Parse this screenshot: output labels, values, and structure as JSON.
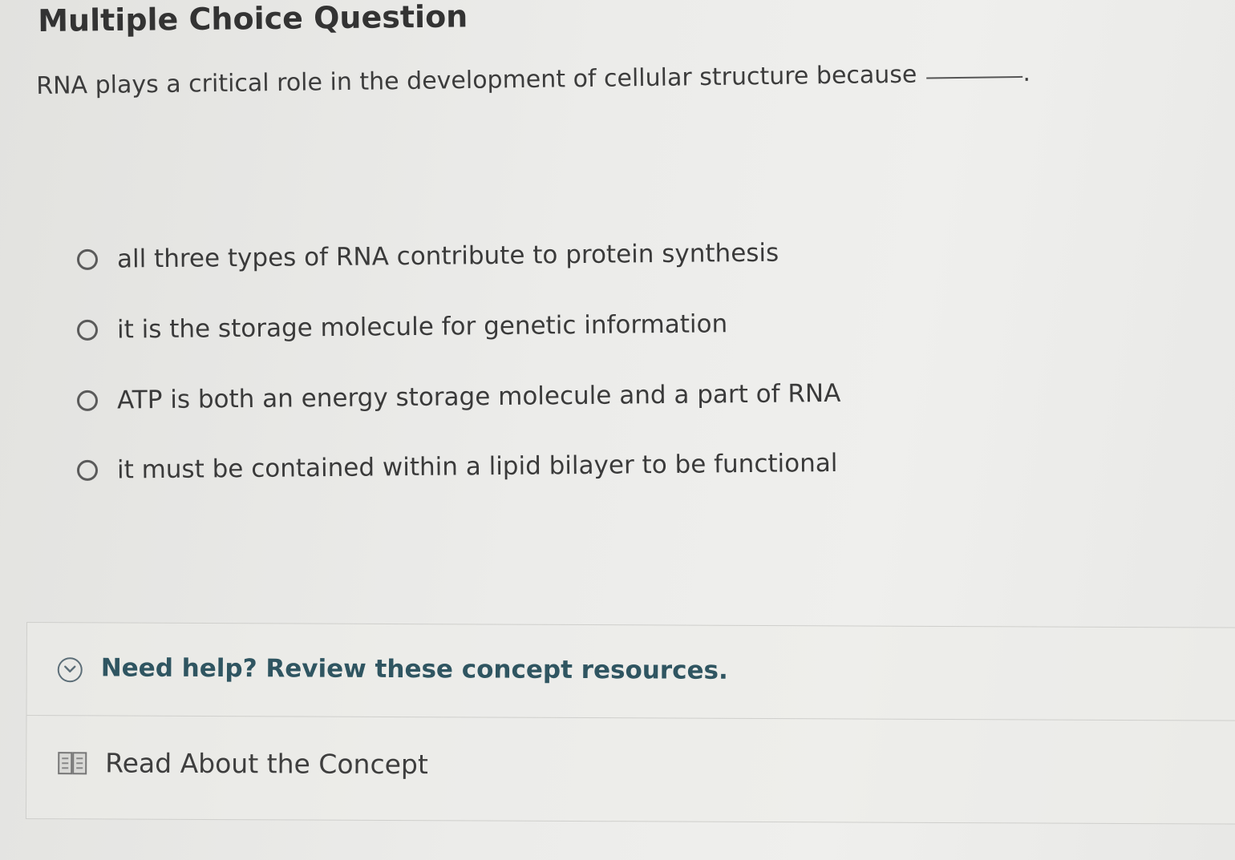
{
  "question": {
    "heading": "Multiple Choice Question",
    "prompt": "RNA plays a critical role in the development of cellular structure because",
    "prompt_end": "."
  },
  "choices": [
    {
      "label": "all three types of RNA contribute to protein synthesis",
      "selected": false
    },
    {
      "label": "it is the storage molecule for genetic information",
      "selected": false
    },
    {
      "label": "ATP is both an energy storage molecule and a part of RNA",
      "selected": false
    },
    {
      "label": "it must be contained within a lipid bilayer to be functional",
      "selected": false
    }
  ],
  "help": {
    "title": "Need help? Review these concept resources.",
    "toggle_icon": "chevron-down-circle-icon",
    "resources": [
      {
        "label": "Read About the Concept",
        "icon": "book-icon"
      }
    ]
  },
  "colors": {
    "heading_text": "#333333",
    "help_title": "#2f5561",
    "background": "#e6e6e3"
  }
}
